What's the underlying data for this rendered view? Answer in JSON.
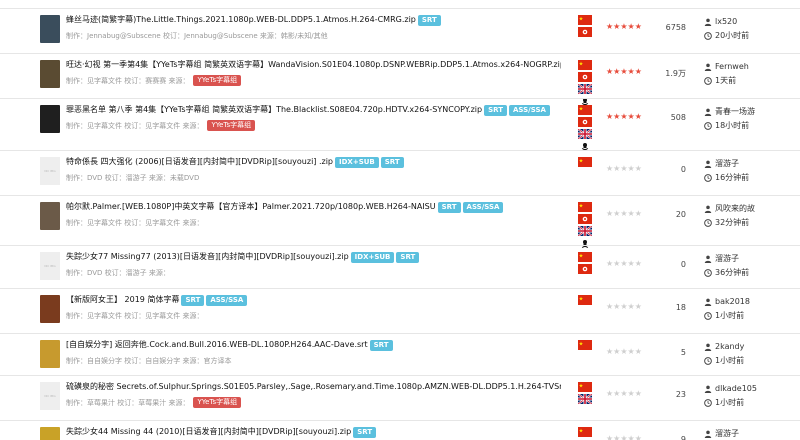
{
  "theme": {
    "tag_blue": "#5bc0de",
    "tag_red": "#d9534f",
    "star_on": "#e74c3c",
    "star_off": "#cfcfcf"
  },
  "rows": [
    {
      "title": "蜂丝马迹(简繁字幕)The.Little.Things.2021.1080p.WEB-DL.DDP5.1.Atmos.H.264-CMRG.zip",
      "tags": [
        "SRT"
      ],
      "meta": "制作：Jennabug@Subscene 校订：Jennabug@Subscene 来源：韩影/未知/其他",
      "meta_badge": "",
      "thumb_color": "#3a4d5c",
      "thumb_placeholder": false,
      "flags": [
        "cn",
        "hk"
      ],
      "stars": 5,
      "downloads": "6758",
      "user": "lx520",
      "time": "20小时前"
    },
    {
      "title": "旺达·幻视 第一季第4集【YYeTs字幕组 简繁英双语字幕】WandaVision.S01E04.1080p.DSNP.WEBRip.DDP5.1.Atmos.x264-NOGRP.zip",
      "tags": [
        "SRT",
        "A"
      ],
      "meta": "制作：见字幕文件 校订：赛赛赛 来源：",
      "meta_badge": "YYeTs字幕组",
      "thumb_color": "#5a4b32",
      "thumb_placeholder": false,
      "flags": [
        "cn",
        "hk",
        "uk",
        "pirate"
      ],
      "stars": 5,
      "downloads": "1.9万",
      "user": "Fernweh",
      "time": "1天前"
    },
    {
      "title": "罪恶黑名单 第八季 第4集【YYeTs字幕组 简繁英双语字幕】The.Blacklist.S08E04.720p.HDTV.x264-SYNCOPY.zip",
      "tags": [
        "SRT",
        "ASS/SSA"
      ],
      "meta": "制作：见字幕文件 校订：见字幕文件 来源：",
      "meta_badge": "YYeTs字幕组",
      "thumb_color": "#1f1f1f",
      "thumb_placeholder": false,
      "flags": [
        "cn",
        "hk",
        "uk",
        "pirate"
      ],
      "stars": 5,
      "downloads": "508",
      "user": "青春一场游",
      "time": "18小时前"
    },
    {
      "title": "特命係長 四大强化 (2006)[日语发音][内封简中][DVDRip][souyouzi] .zip",
      "tags": [
        "IDX+SUB",
        "SRT"
      ],
      "meta": "制作：DVD 校订：溜游子 来源：未载DVD",
      "meta_badge": "",
      "thumb_color": "#eeeeee",
      "thumb_placeholder": true,
      "flags": [
        "cn"
      ],
      "stars": 0,
      "downloads": "0",
      "user": "溜游子",
      "time": "16分钟前"
    },
    {
      "title": "帕尔默.Palmer.[WEB.1080P]中英文字幕【官方译本】Palmer.2021.720p/1080p.WEB.H264-NAISU",
      "tags": [
        "SRT",
        "ASS/SSA"
      ],
      "meta": "制作：见字幕文件 校订：见字幕文件 来源：",
      "meta_badge": "",
      "thumb_color": "#6b5a48",
      "thumb_placeholder": false,
      "flags": [
        "cn",
        "hk",
        "uk",
        "pirate"
      ],
      "stars": 0,
      "downloads": "20",
      "user": "风吹来的故",
      "time": "32分钟前"
    },
    {
      "title": "失踪少女77 Missing77 (2013)[日语发音][内封简中][DVDRip][souyouzi].zip",
      "tags": [
        "IDX+SUB",
        "SRT"
      ],
      "meta": "制作：DVD 校订：溜游子 来源：",
      "meta_badge": "",
      "thumb_color": "#eeeeee",
      "thumb_placeholder": true,
      "flags": [
        "cn",
        "hk"
      ],
      "stars": 0,
      "downloads": "0",
      "user": "溜游子",
      "time": "36分钟前"
    },
    {
      "title": "【新版阿女王】 2019 简体字幕",
      "tags": [
        "SRT",
        "ASS/SSA"
      ],
      "meta": "制作：见字幕文件 校订：见字幕文件 来源：",
      "meta_badge": "",
      "thumb_color": "#7a3b1e",
      "thumb_placeholder": false,
      "flags": [
        "cn"
      ],
      "stars": 0,
      "downloads": "18",
      "user": "bak2018",
      "time": "1小时前"
    },
    {
      "title": "[自自娱分字] 返回奔他.Cock.and.Bull.2016.WEB-DL.1080P.H264.AAC-Dave.srt",
      "tags": [
        "SRT"
      ],
      "meta": "制作：自自娱分字 校订：自自娱分字 来源：官方译本",
      "meta_badge": "",
      "thumb_color": "#c79a2e",
      "thumb_placeholder": false,
      "flags": [
        "cn"
      ],
      "stars": 0,
      "downloads": "5",
      "user": "2kandy",
      "time": "1小时前"
    },
    {
      "title": "硫磺泉的秘密 Secrets.of.Sulphur.Springs.S01E05.Parsley,.Sage,.Rosemary.and.Time.1080p.AMZN.WEB-DL.DDP5.1.H.264-TVSmash",
      "tags": [
        "SRT"
      ],
      "meta": "制作：草莓果汁 校订：草莓果汁 来源：",
      "meta_badge": "YYeTs字幕组",
      "thumb_color": "#eeeeee",
      "thumb_placeholder": true,
      "flags": [
        "cn",
        "uk"
      ],
      "stars": 0,
      "downloads": "23",
      "user": "dlkade105",
      "time": "1小时前"
    },
    {
      "title": "失踪少女44 Missing 44 (2010)[日语发音][内封简中][DVDRip][souyouzi].zip",
      "tags": [
        "SRT"
      ],
      "meta": "",
      "meta_badge": "",
      "thumb_color": "#c9a227",
      "thumb_placeholder": false,
      "flags": [
        "cn"
      ],
      "stars": 0,
      "downloads": "9",
      "user": "溜游子",
      "time": ""
    }
  ]
}
